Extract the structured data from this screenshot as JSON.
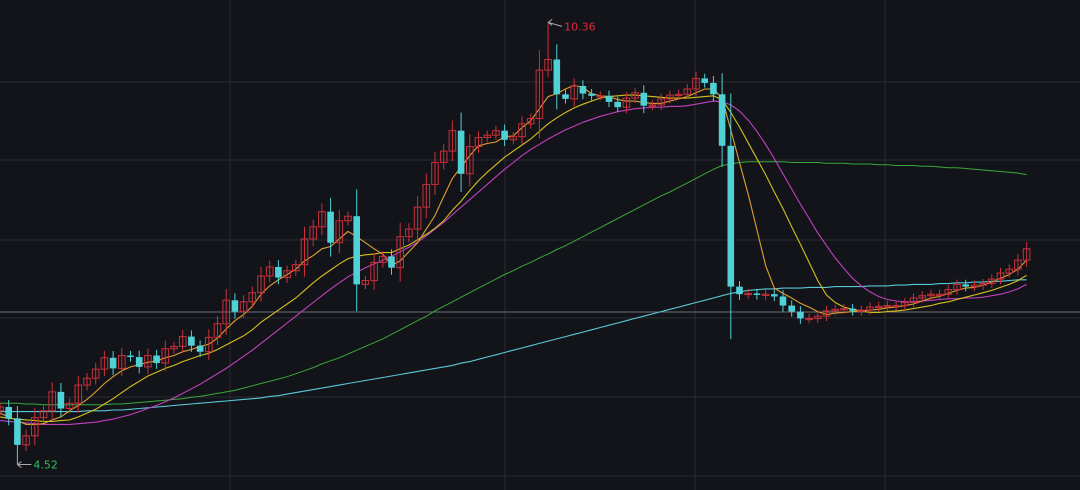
{
  "chart_data": {
    "type": "candlestick",
    "title": "",
    "annotations": {
      "high": {
        "label": "10.36",
        "value": 10.36,
        "index": 63,
        "color": "#e0283c"
      },
      "low": {
        "label": "4.52",
        "value": 4.52,
        "index": 2,
        "color": "#2fbf5a"
      }
    },
    "ylim": [
      4.25,
      10.55
    ],
    "grid": true,
    "colors": {
      "background": "#131419",
      "grid": "#2b2d33",
      "up": "#c9303b",
      "down": "#4fd1d6",
      "ma_short": "#e0a030",
      "ma_mid": "#d4c020",
      "ma_magenta": "#c040c0",
      "ma_green": "#3aa83a",
      "ma_cyan": "#5ac8d8"
    },
    "close": [
      5.28,
      5.13,
      4.78,
      4.9,
      5.14,
      5.23,
      5.48,
      5.26,
      5.33,
      5.57,
      5.66,
      5.78,
      5.93,
      5.79,
      5.96,
      5.94,
      5.81,
      5.96,
      5.86,
      6.05,
      6.08,
      6.21,
      6.09,
      6.01,
      6.2,
      6.38,
      6.69,
      6.54,
      6.67,
      6.79,
      7.01,
      7.13,
      6.99,
      7.08,
      7.16,
      7.5,
      7.66,
      7.86,
      7.45,
      7.74,
      7.8,
      6.9,
      6.95,
      7.19,
      7.27,
      7.12,
      7.53,
      7.63,
      7.92,
      8.22,
      8.51,
      8.66,
      8.93,
      8.36,
      8.72,
      8.84,
      8.87,
      8.93,
      8.81,
      8.85,
      9.02,
      9.09,
      9.73,
      9.87,
      9.41,
      9.35,
      9.52,
      9.42,
      9.39,
      9.39,
      9.31,
      9.24,
      9.36,
      9.43,
      9.26,
      9.27,
      9.35,
      9.4,
      9.41,
      9.48,
      9.62,
      9.56,
      9.41,
      8.73,
      6.87,
      6.77,
      6.78,
      6.76,
      6.77,
      6.74,
      6.62,
      6.54,
      6.45,
      6.45,
      6.48,
      6.55,
      6.57,
      6.58,
      6.55,
      6.56,
      6.6,
      6.61,
      6.62,
      6.62,
      6.66,
      6.72,
      6.75,
      6.77,
      6.77,
      6.83,
      6.9,
      6.87,
      6.89,
      6.91,
      6.97,
      7.05,
      7.1,
      7.22,
      7.37
    ],
    "ma_short": [
      5.2,
      5.15,
      5.1,
      5.05,
      5.05,
      5.06,
      5.11,
      5.15,
      5.23,
      5.3,
      5.38,
      5.48,
      5.59,
      5.68,
      5.76,
      5.81,
      5.84,
      5.87,
      5.89,
      5.93,
      5.96,
      6.01,
      6.04,
      6.08,
      6.11,
      6.19,
      6.31,
      6.42,
      6.5,
      6.61,
      6.77,
      6.88,
      6.96,
      7.03,
      7.1,
      7.21,
      7.28,
      7.37,
      7.4,
      7.5,
      7.6,
      7.53,
      7.45,
      7.37,
      7.3,
      7.15,
      7.21,
      7.33,
      7.45,
      7.63,
      7.81,
      8.06,
      8.3,
      8.45,
      8.6,
      8.73,
      8.76,
      8.78,
      8.85,
      8.86,
      8.97,
      9.06,
      9.22,
      9.38,
      9.42,
      9.48,
      9.53,
      9.5,
      9.42,
      9.39,
      9.38,
      9.34,
      9.32,
      9.32,
      9.3,
      9.29,
      9.29,
      9.32,
      9.35,
      9.38,
      9.43,
      9.48,
      9.48,
      9.36,
      8.94,
      8.51,
      8.09,
      7.62,
      7.15,
      6.85,
      6.78,
      6.72,
      6.65,
      6.6,
      6.54,
      6.5,
      6.52,
      6.53,
      6.54,
      6.55,
      6.56,
      6.57,
      6.59,
      6.6,
      6.62,
      6.64,
      6.68,
      6.72,
      6.74,
      6.78,
      6.82,
      6.85,
      6.86,
      6.89,
      6.93,
      6.98,
      7.03,
      7.1,
      7.22
    ],
    "ma_mid": [
      5.15,
      5.13,
      5.12,
      5.11,
      5.1,
      5.09,
      5.09,
      5.1,
      5.11,
      5.15,
      5.2,
      5.25,
      5.32,
      5.39,
      5.47,
      5.55,
      5.62,
      5.69,
      5.74,
      5.79,
      5.83,
      5.88,
      5.92,
      5.96,
      5.99,
      6.04,
      6.1,
      6.16,
      6.22,
      6.3,
      6.4,
      6.48,
      6.56,
      6.64,
      6.72,
      6.82,
      6.92,
      7.01,
      7.09,
      7.17,
      7.24,
      7.27,
      7.29,
      7.3,
      7.32,
      7.32,
      7.37,
      7.42,
      7.49,
      7.56,
      7.64,
      7.74,
      7.88,
      8.0,
      8.14,
      8.27,
      8.38,
      8.48,
      8.58,
      8.66,
      8.74,
      8.82,
      8.92,
      9.02,
      9.1,
      9.17,
      9.23,
      9.28,
      9.32,
      9.36,
      9.38,
      9.39,
      9.4,
      9.4,
      9.39,
      9.38,
      9.37,
      9.36,
      9.36,
      9.36,
      9.37,
      9.38,
      9.39,
      9.34,
      9.17,
      8.98,
      8.77,
      8.56,
      8.35,
      8.12,
      7.9,
      7.66,
      7.43,
      7.19,
      6.95,
      6.76,
      6.66,
      6.6,
      6.57,
      6.55,
      6.53,
      6.53,
      6.54,
      6.55,
      6.56,
      6.58,
      6.6,
      6.62,
      6.65,
      6.67,
      6.7,
      6.73,
      6.76,
      6.79,
      6.82,
      6.86,
      6.9,
      6.95,
      7.02
    ],
    "ma_magenta": [
      5.1,
      5.09,
      5.08,
      5.07,
      5.06,
      5.05,
      5.05,
      5.05,
      5.05,
      5.06,
      5.07,
      5.08,
      5.1,
      5.12,
      5.15,
      5.18,
      5.22,
      5.26,
      5.3,
      5.35,
      5.4,
      5.46,
      5.52,
      5.58,
      5.65,
      5.72,
      5.79,
      5.87,
      5.95,
      6.03,
      6.12,
      6.21,
      6.3,
      6.39,
      6.48,
      6.57,
      6.66,
      6.75,
      6.84,
      6.92,
      7.0,
      7.06,
      7.12,
      7.17,
      7.22,
      7.27,
      7.33,
      7.39,
      7.46,
      7.54,
      7.63,
      7.72,
      7.82,
      7.92,
      8.02,
      8.12,
      8.22,
      8.32,
      8.42,
      8.51,
      8.6,
      8.68,
      8.75,
      8.82,
      8.88,
      8.94,
      8.99,
      9.04,
      9.08,
      9.12,
      9.15,
      9.18,
      9.2,
      9.22,
      9.23,
      9.24,
      9.24,
      9.25,
      9.25,
      9.26,
      9.28,
      9.3,
      9.32,
      9.31,
      9.27,
      9.19,
      9.07,
      8.92,
      8.75,
      8.56,
      8.36,
      8.16,
      7.96,
      7.77,
      7.58,
      7.41,
      7.25,
      7.11,
      6.98,
      6.88,
      6.8,
      6.74,
      6.7,
      6.68,
      6.67,
      6.67,
      6.68,
      6.69,
      6.7,
      6.71,
      6.71,
      6.72,
      6.72,
      6.73,
      6.75,
      6.77,
      6.8,
      6.84,
      6.9
    ],
    "ma_green": [
      5.33,
      5.33,
      5.33,
      5.32,
      5.32,
      5.31,
      5.31,
      5.31,
      5.31,
      5.31,
      5.31,
      5.31,
      5.31,
      5.32,
      5.32,
      5.33,
      5.34,
      5.35,
      5.36,
      5.37,
      5.38,
      5.39,
      5.41,
      5.42,
      5.44,
      5.46,
      5.48,
      5.5,
      5.53,
      5.56,
      5.59,
      5.62,
      5.65,
      5.68,
      5.72,
      5.76,
      5.8,
      5.85,
      5.89,
      5.93,
      5.98,
      6.03,
      6.08,
      6.13,
      6.18,
      6.24,
      6.3,
      6.36,
      6.42,
      6.48,
      6.55,
      6.61,
      6.67,
      6.73,
      6.79,
      6.85,
      6.91,
      6.97,
      7.03,
      7.08,
      7.14,
      7.19,
      7.25,
      7.3,
      7.36,
      7.41,
      7.47,
      7.53,
      7.59,
      7.65,
      7.71,
      7.77,
      7.83,
      7.89,
      7.95,
      8.01,
      8.07,
      8.12,
      8.18,
      8.24,
      8.3,
      8.36,
      8.42,
      8.47,
      8.49,
      8.51,
      8.52,
      8.52,
      8.52,
      8.52,
      8.52,
      8.51,
      8.51,
      8.51,
      8.51,
      8.5,
      8.5,
      8.5,
      8.49,
      8.49,
      8.49,
      8.48,
      8.48,
      8.47,
      8.47,
      8.47,
      8.46,
      8.46,
      8.45,
      8.44,
      8.44,
      8.43,
      8.42,
      8.41,
      8.4,
      8.39,
      8.38,
      8.37,
      8.35
    ],
    "ma_cyan": [
      5.22,
      5.22,
      5.22,
      5.22,
      5.22,
      5.22,
      5.22,
      5.22,
      5.22,
      5.22,
      5.23,
      5.23,
      5.23,
      5.24,
      5.24,
      5.25,
      5.26,
      5.27,
      5.28,
      5.29,
      5.3,
      5.31,
      5.32,
      5.33,
      5.34,
      5.35,
      5.36,
      5.37,
      5.38,
      5.39,
      5.4,
      5.42,
      5.43,
      5.45,
      5.47,
      5.49,
      5.51,
      5.53,
      5.55,
      5.57,
      5.59,
      5.61,
      5.63,
      5.65,
      5.67,
      5.69,
      5.71,
      5.73,
      5.75,
      5.77,
      5.79,
      5.81,
      5.83,
      5.86,
      5.88,
      5.91,
      5.94,
      5.97,
      6.0,
      6.03,
      6.06,
      6.09,
      6.12,
      6.15,
      6.18,
      6.21,
      6.24,
      6.27,
      6.3,
      6.33,
      6.36,
      6.39,
      6.42,
      6.45,
      6.48,
      6.51,
      6.54,
      6.57,
      6.6,
      6.63,
      6.66,
      6.69,
      6.72,
      6.75,
      6.78,
      6.8,
      6.82,
      6.83,
      6.84,
      6.84,
      6.85,
      6.85,
      6.85,
      6.86,
      6.86,
      6.86,
      6.87,
      6.87,
      6.87,
      6.87,
      6.88,
      6.88,
      6.88,
      6.89,
      6.89,
      6.9,
      6.9,
      6.9,
      6.91,
      6.91,
      6.92,
      6.92,
      6.93,
      6.93,
      6.94,
      6.94,
      6.95,
      6.96,
      6.96
    ]
  }
}
